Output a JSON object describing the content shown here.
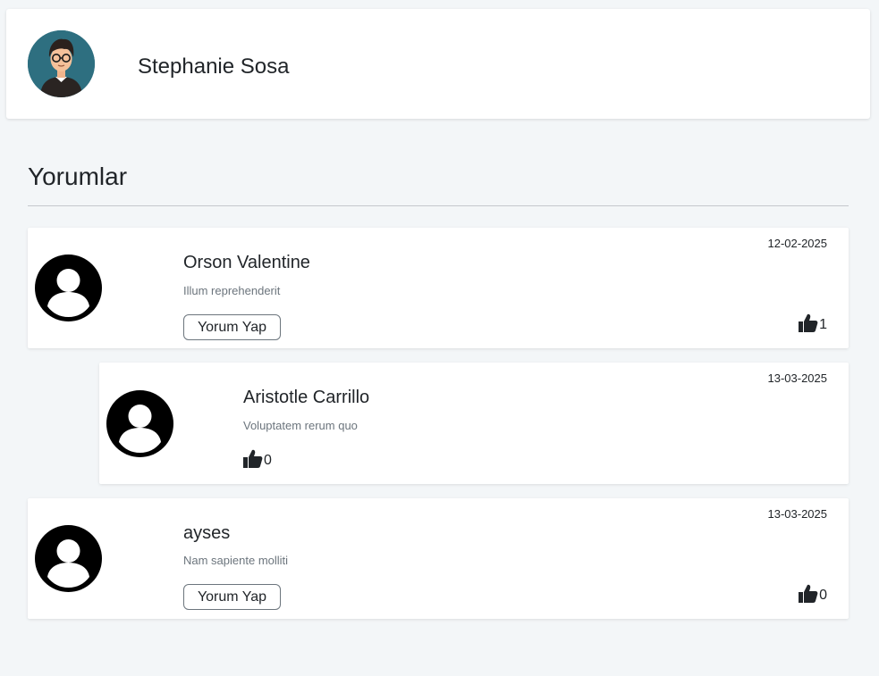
{
  "profile": {
    "name": "Stephanie Sosa",
    "avatar_icon": "user-cartoon-avatar-icon"
  },
  "section": {
    "title": "Yorumlar"
  },
  "comments": [
    {
      "author": "Orson Valentine",
      "text": "Illum reprehenderit",
      "date": "12-02-2025",
      "likes": "1",
      "reply_label": "Yorum Yap",
      "is_reply": false
    },
    {
      "author": "Aristotle Carrillo",
      "text": "Voluptatem rerum quo",
      "date": "13-03-2025",
      "likes": "0",
      "is_reply": true
    },
    {
      "author": "ayses",
      "text": "Nam sapiente molliti",
      "date": "13-03-2025",
      "likes": "0",
      "reply_label": "Yorum Yap",
      "is_reply": false
    }
  ],
  "icons": {
    "avatar": "user-circle-icon",
    "like": "thumbs-up-icon"
  }
}
